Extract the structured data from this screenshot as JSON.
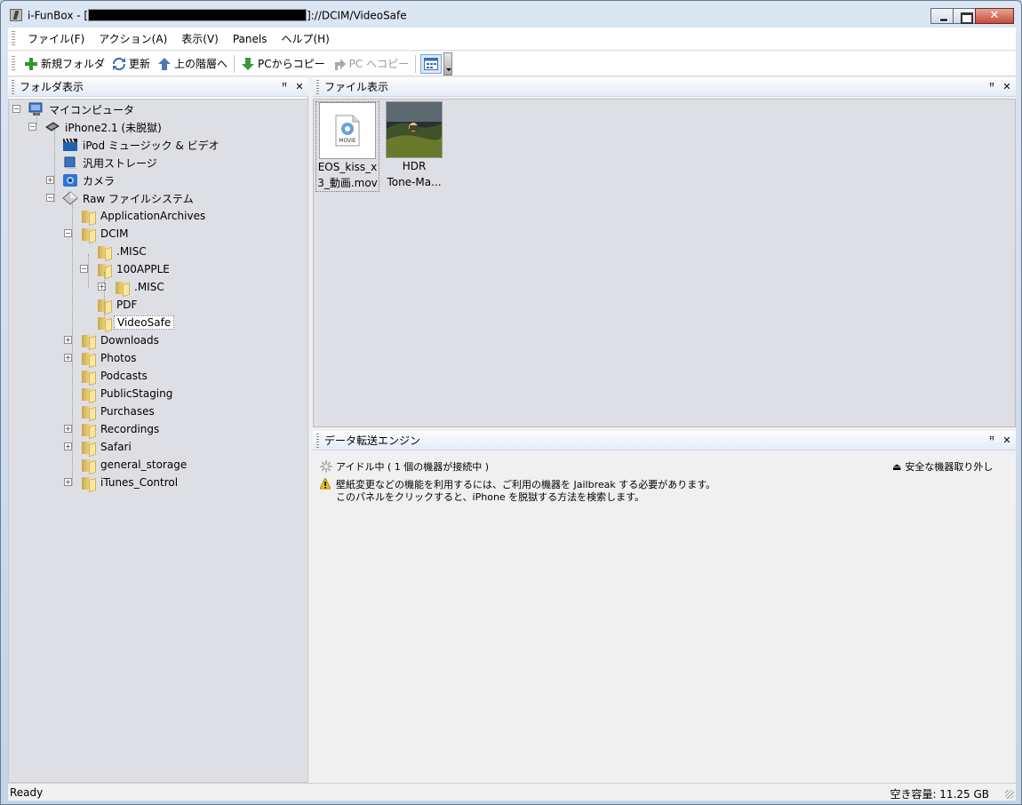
{
  "window": {
    "title_prefix": "i-FunBox - [",
    "title_suffix": "]://DCIM/VideoSafe"
  },
  "menu": [
    "ファイル(F)",
    "アクション(A)",
    "表示(V)",
    "Panels",
    "ヘルプ(H)"
  ],
  "toolbar": {
    "new_folder": "新規フォルダ",
    "refresh": "更新",
    "up": "上の階層へ",
    "copy_from_pc": "PCからコピー",
    "copy_to_pc": "PC へコピー"
  },
  "folder_panel": {
    "title": "フォルダ表示",
    "tree": [
      {
        "label": "マイコンピュータ",
        "icon": "computer-icon"
      },
      {
        "label": "iPhone2.1 (未脱獄)",
        "icon": "iphone-icon"
      },
      {
        "label": "iPod ミュージック & ビデオ",
        "icon": "movie-clapper-icon"
      },
      {
        "label": "汎用ストレージ",
        "icon": "storage-icon"
      },
      {
        "label": "カメラ",
        "icon": "camera-icon"
      },
      {
        "label": "Raw ファイルシステム",
        "icon": "filesystem-icon"
      },
      {
        "label": "ApplicationArchives"
      },
      {
        "label": "DCIM"
      },
      {
        "label": ".MISC"
      },
      {
        "label": "100APPLE"
      },
      {
        "label": ".MISC"
      },
      {
        "label": "PDF"
      },
      {
        "label": "VideoSafe"
      },
      {
        "label": "Downloads"
      },
      {
        "label": "Photos"
      },
      {
        "label": "Podcasts"
      },
      {
        "label": "PublicStaging"
      },
      {
        "label": "Purchases"
      },
      {
        "label": "Recordings"
      },
      {
        "label": "Safari"
      },
      {
        "label": "general_storage"
      },
      {
        "label": "iTunes_Control"
      }
    ]
  },
  "file_panel": {
    "title": "ファイル表示",
    "files": [
      {
        "line1": "EOS_kiss_x",
        "line2": "3_動画.mov",
        "icon": "movie-file-icon",
        "badge": "MOVIE"
      },
      {
        "line1": "HDR",
        "line2": "Tone-Ma...",
        "icon": "image-thumbnail"
      }
    ]
  },
  "transfer_panel": {
    "title": "データ転送エンジン",
    "status": "アイドル中 ( 1 個の機器が接続中 )",
    "eject": "安全な機器取り外し",
    "warning_line1": "壁紙変更などの機能を利用するには、ご利用の機器を Jailbreak する必要があります。",
    "warning_line2": "このパネルをクリックすると、iPhone を脱獄する方法を検索します。"
  },
  "statusbar": {
    "left": "Ready",
    "right": "空き容量: 11.25 GB"
  }
}
